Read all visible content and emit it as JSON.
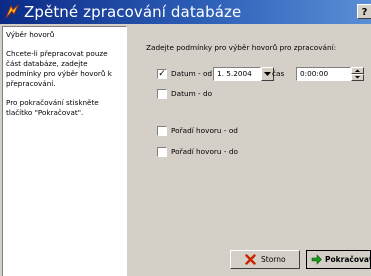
{
  "window": {
    "title": "Zpětné zpracování databáze",
    "help_label": "?"
  },
  "info_panel": {
    "heading": "Výběr hovorů",
    "text_1": "Chcete-li přepracovat pouze část databáze, zadejte podmínky pro výběr hovorů k přepracování.",
    "text_2": "Pro pokračování stiskněte tlačítko \"Pokračovat\"."
  },
  "form": {
    "instruction": "Zadejte podmínky pro výběr hovorů pro zpracování:",
    "datum_od": {
      "label": "Datum - od",
      "checked": true,
      "value": "1. 5.2004"
    },
    "cas": {
      "label": "čas",
      "value": "0:00:00"
    },
    "datum_do": {
      "label": "Datum - do",
      "checked": false
    },
    "poradi_od": {
      "label": "Pořadí hovoru - od",
      "checked": false
    },
    "poradi_do": {
      "label": "Pořadí hovoru - do",
      "checked": false
    }
  },
  "buttons": {
    "cancel_label": "Storno",
    "continue_label": "Pokračovat"
  },
  "icons": {
    "app": "app-icon",
    "cancel": "x-icon",
    "continue": "arrow-right-icon",
    "dropdown": "chevron-down-icon",
    "spin_up": "spin-up-icon",
    "spin_down": "spin-down-icon"
  },
  "colors": {
    "title_bar_start": "#0b2a86",
    "title_bar_end": "#5a8fd6",
    "cancel_icon": "#cc2200",
    "continue_icon": "#1a9a1a"
  }
}
